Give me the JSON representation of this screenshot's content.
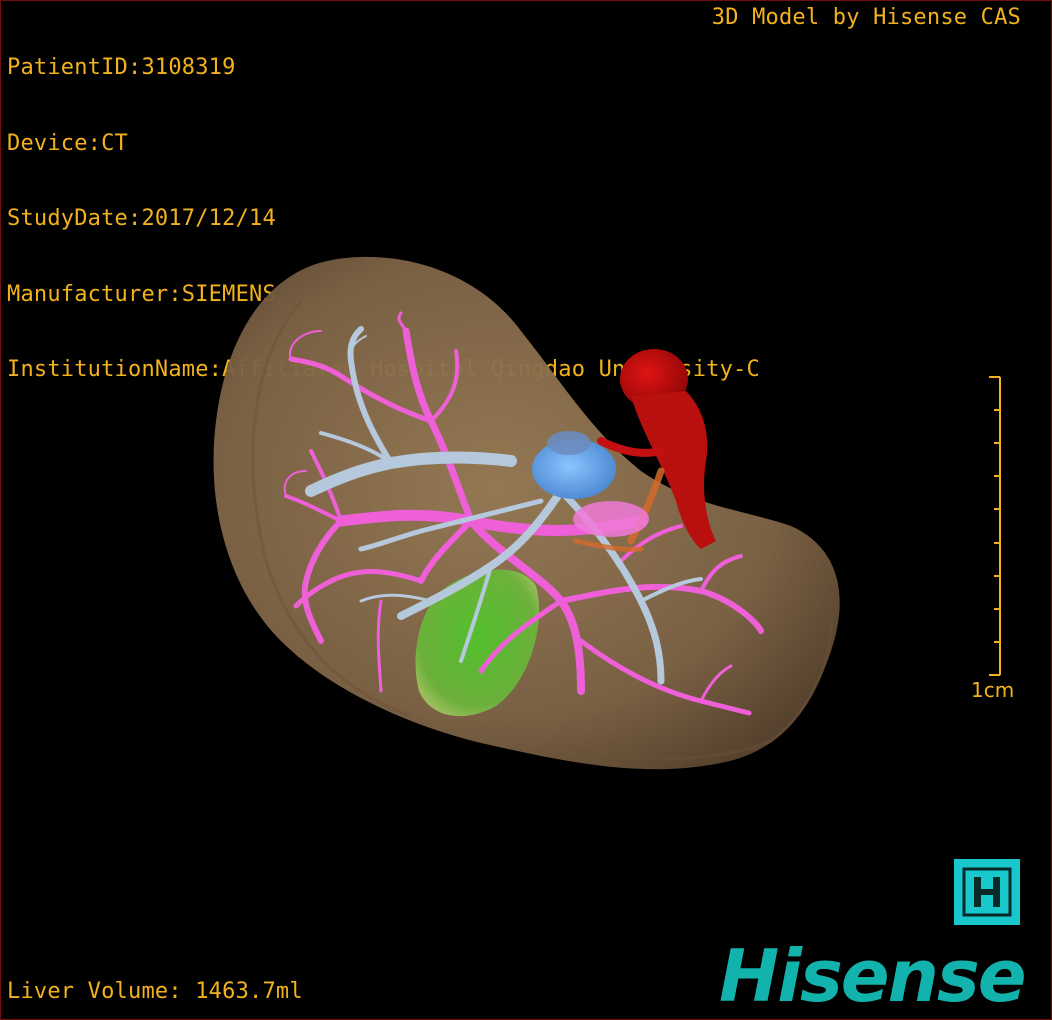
{
  "study_info": {
    "patient_id": "PatientID:3108319",
    "device": "Device:CT",
    "study_date": "StudyDate:2017/12/14",
    "manufacturer": "Manufacturer:SIEMENS",
    "institution": "InstitutionName:Affiliated Hospital Qingdao University-C"
  },
  "watermark": "3D Model by Hisense CAS",
  "scale_bar": {
    "label": "1cm",
    "ticks": 10
  },
  "liver_volume": "Liver Volume: 1463.7ml",
  "brand": {
    "name": "Hisense",
    "icon_letter": "H",
    "color": "#13b3ad",
    "icon_color": "#18c8cc"
  },
  "colors": {
    "overlay_text": "#f2b21e",
    "liver": "#8c7150",
    "portal_vein": "#ee5fd8",
    "hepatic_vein": "#b6c8dc",
    "gallbladder": "#8cdc3c",
    "ivc": "#cc0d0d",
    "lesion": "#7ab4f0"
  }
}
